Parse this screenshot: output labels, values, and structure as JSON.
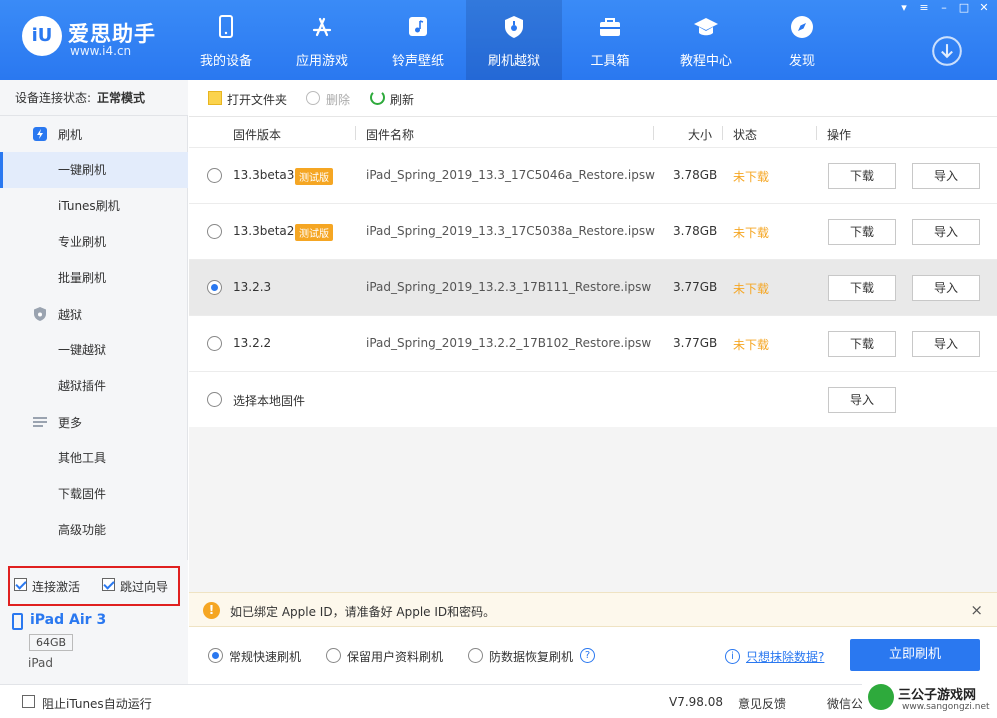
{
  "app": {
    "logo_mark": "iU",
    "title": "爱思助手",
    "url": "www.i4.cn"
  },
  "nav": [
    {
      "label": "我的设备",
      "icon": "phone-icon"
    },
    {
      "label": "应用游戏",
      "icon": "app-store-icon"
    },
    {
      "label": "铃声壁纸",
      "icon": "music-icon"
    },
    {
      "label": "刷机越狱",
      "icon": "shield-icon",
      "active": true
    },
    {
      "label": "工具箱",
      "icon": "toolbox-icon"
    },
    {
      "label": "教程中心",
      "icon": "graduation-cap-icon"
    },
    {
      "label": "发现",
      "icon": "compass-icon"
    }
  ],
  "sidebar": {
    "status_label": "设备连接状态:",
    "status_value": "正常模式",
    "groups": [
      {
        "label": "刷机",
        "icon": "flash-icon"
      },
      {
        "label": "越狱",
        "icon": "shield-icon"
      },
      {
        "label": "更多",
        "icon": "menu-icon"
      }
    ],
    "items": [
      "一键刷机",
      "iTunes刷机",
      "专业刷机",
      "批量刷机",
      "一键越狱",
      "越狱插件",
      "其他工具",
      "下载固件",
      "高级功能"
    ],
    "checkbox_activate": "连接激活",
    "checkbox_skip": "跳过向导",
    "device_name": "iPad Air 3",
    "device_capacity": "64GB",
    "device_type": "iPad"
  },
  "toolbar": {
    "open_folder": "打开文件夹",
    "delete": "删除",
    "refresh": "刷新"
  },
  "table": {
    "headers": [
      "固件版本",
      "固件名称",
      "大小",
      "状态",
      "操作"
    ],
    "rows": [
      {
        "version": "13.3beta3",
        "badge": "测试版",
        "name": "iPad_Spring_2019_13.3_17C5046a_Restore.ipsw",
        "size": "3.78GB",
        "status": "未下载"
      },
      {
        "version": "13.3beta2",
        "badge": "测试版",
        "name": "iPad_Spring_2019_13.3_17C5038a_Restore.ipsw",
        "size": "3.78GB",
        "status": "未下载"
      },
      {
        "version": "13.2.3",
        "badge": "",
        "name": "iPad_Spring_2019_13.2.3_17B111_Restore.ipsw",
        "size": "3.77GB",
        "status": "未下载"
      },
      {
        "version": "13.2.2",
        "badge": "",
        "name": "iPad_Spring_2019_13.2.2_17B102_Restore.ipsw",
        "size": "3.77GB",
        "status": "未下载"
      }
    ],
    "local_label": "选择本地固件",
    "download_btn": "下载",
    "import_btn": "导入"
  },
  "notice": {
    "text": "如已绑定 Apple ID，请准备好 Apple ID和密码。",
    "close": "×"
  },
  "flash_options": {
    "option1": "常规快速刷机",
    "option2": "保留用户资料刷机",
    "option3": "防数据恢复刷机",
    "help": "?",
    "link_info": "i",
    "link": "只想抹除数据?",
    "primary": "立即刷机"
  },
  "statusbar": {
    "itunes_block": "阻止iTunes自动运行",
    "version": "V7.98.08",
    "feedback": "意见反馈",
    "wechat": "微信公众号"
  },
  "watermark": {
    "title": "三公子游戏网",
    "url": "www.sangongzi.net"
  },
  "colors": {
    "brand": "#2a78f0",
    "status_orange": "#f5a623",
    "highlight_red": "#e02020"
  }
}
